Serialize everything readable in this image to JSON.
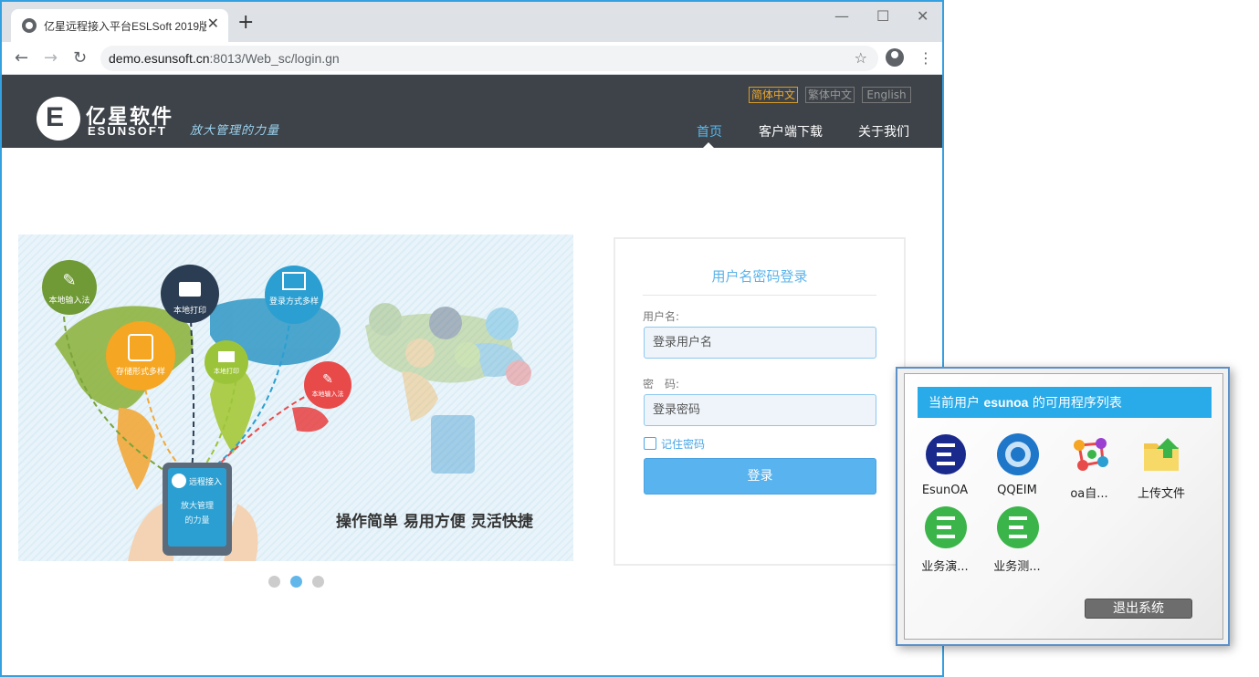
{
  "browser": {
    "tab_title": "亿星远程接入平台ESLSoft 2019版",
    "url_host": "demo.esunsoft.cn",
    "url_rest": ":8013/Web_sc/login.gn",
    "icons": [
      "globe-icon",
      "close-icon",
      "plus-icon",
      "minimize-icon",
      "maximize-icon",
      "window-close-icon",
      "back-icon",
      "forward-icon",
      "reload-icon",
      "star-icon",
      "profile-icon",
      "menu-icon"
    ]
  },
  "header": {
    "logo_cn": "亿星软件",
    "logo_en": "ESUNSOFT",
    "slogan": "放大管理的力量",
    "languages": [
      "简体中文",
      "繁体中文",
      "English"
    ],
    "nav": [
      "首页",
      "客户端下载",
      "关于我们"
    ],
    "background": "#3e4349",
    "accent": "#58b9ee"
  },
  "banner": {
    "bubbles": [
      "本地输入法",
      "本地打印",
      "登录方式多样",
      "存储形式多样",
      "本地打印",
      "本地输入法"
    ],
    "tablet_title": "远程接入",
    "tablet_slogan": "放大管理的力量",
    "tagline": "操作简单  易用方便  灵活快捷",
    "slide_count": 3,
    "active_slide": 2
  },
  "login": {
    "title": "用户名密码登录",
    "username_label": "用户名:",
    "username_placeholder": "登录用户名",
    "password_label": "密　码:",
    "password_placeholder": "登录密码",
    "remember_label": "记住密码",
    "submit_label": "登录"
  },
  "dialog": {
    "header_prefix": "当前用户 ",
    "user": "esunoa",
    "header_suffix": " 的可用程序列表",
    "apps": [
      {
        "label": "EsunOA",
        "icon": "esunoa-icon"
      },
      {
        "label": "QQEIM",
        "icon": "qqeim-icon"
      },
      {
        "label": "oa自...",
        "icon": "molecule-icon"
      },
      {
        "label": "上传文件",
        "icon": "upload-folder-icon"
      },
      {
        "label": "业务演...",
        "icon": "green-e-icon"
      },
      {
        "label": "业务测...",
        "icon": "green-e-icon"
      }
    ],
    "logout_label": "退出系统",
    "header_color": "#29abe9"
  }
}
